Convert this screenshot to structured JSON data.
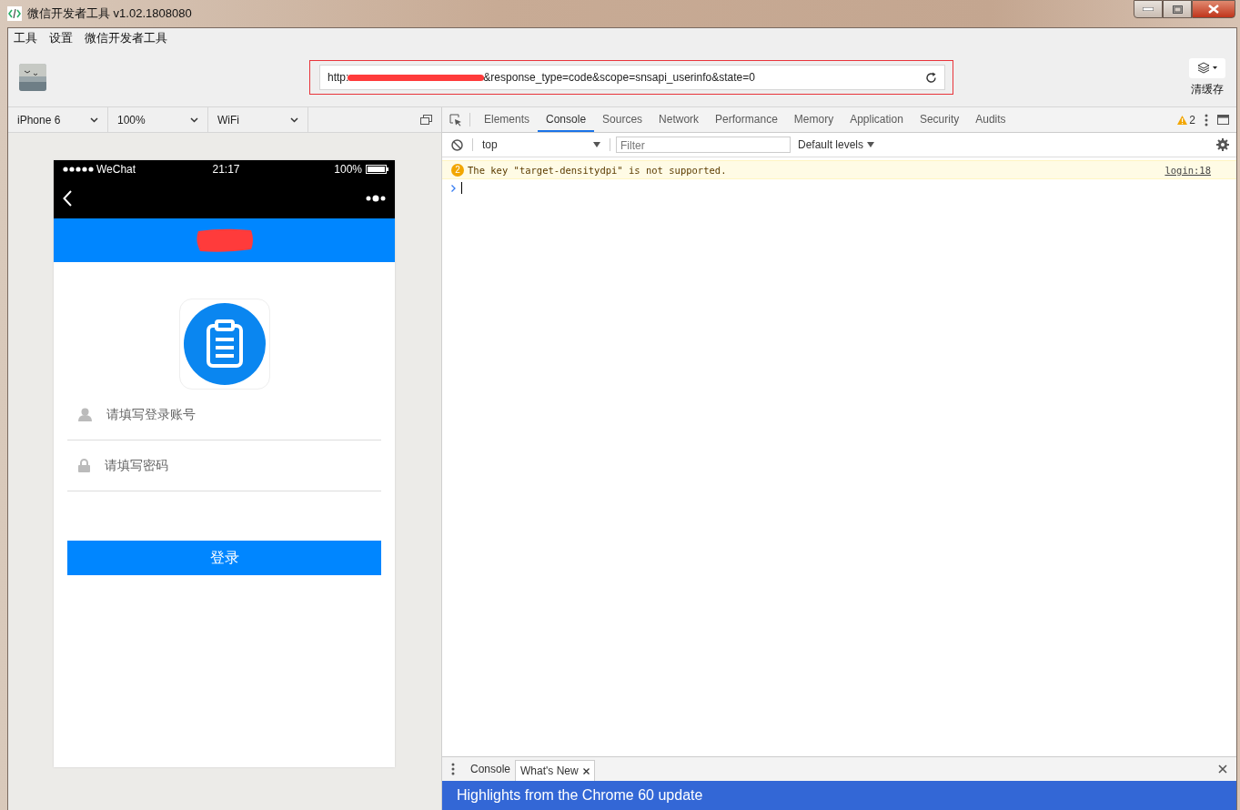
{
  "window": {
    "title": "微信开发者工具 v1.02.1808080"
  },
  "menu": [
    {
      "label": "工具"
    },
    {
      "label": "设置"
    },
    {
      "label": "微信开发者工具"
    }
  ],
  "address": {
    "value_start": "http:",
    "value_end": "&response_type=code&scope=snsapi_userinfo&state=0"
  },
  "cache_button": {
    "label": "清缓存"
  },
  "device_bar": [
    {
      "label": "iPhone 6"
    },
    {
      "label": "100%"
    },
    {
      "label": "WiFi"
    }
  ],
  "phone": {
    "carrier": "WeChat",
    "time": "21:17",
    "battery": "100%",
    "fields": [
      {
        "kind": "user",
        "placeholder": "请填写登录账号"
      },
      {
        "kind": "lock",
        "placeholder": "请填写密码"
      }
    ],
    "login_button": "登录"
  },
  "devtools": {
    "tabs": [
      {
        "label": "Elements",
        "selected": false
      },
      {
        "label": "Console",
        "selected": true
      },
      {
        "label": "Sources",
        "selected": false
      },
      {
        "label": "Network",
        "selected": false
      },
      {
        "label": "Performance",
        "selected": false
      },
      {
        "label": "Memory",
        "selected": false
      },
      {
        "label": "Application",
        "selected": false
      },
      {
        "label": "Security",
        "selected": false
      },
      {
        "label": "Audits",
        "selected": false
      }
    ],
    "warning_count": "2",
    "context": "top",
    "filter_placeholder": "Filter",
    "levels": "Default levels",
    "messages": [
      {
        "count": "2",
        "text": "The key \"target-densitydpi\" is not supported.",
        "source": "login:18"
      }
    ],
    "drawer_tabs": [
      {
        "label": "Console",
        "selected": false
      },
      {
        "label": "What's New",
        "selected": true
      }
    ],
    "whats_new_title": "Highlights from the Chrome 60 update"
  }
}
